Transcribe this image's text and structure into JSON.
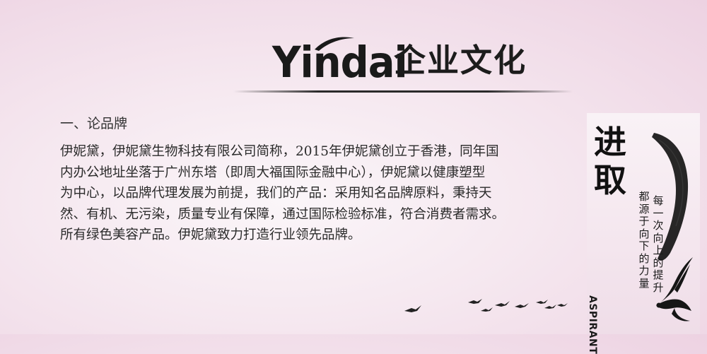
{
  "brand": {
    "logo_text": "Yindai",
    "title": "企业文化"
  },
  "section": {
    "heading": "一、论品牌",
    "lines": [
      "伊妮黛，伊妮黛生物科技有限公司简称，2015年伊妮黛创立于香港，同年国",
      "内办公地址坐落于广州东塔（即周大福国际金融中心），伊妮黛以健康塑型",
      "为中心，以品牌代理发展为前提，我们的产品：采用知名品牌原料，秉持天",
      "然、有机、无污染，质量专业有保障，通过国际检验标准，符合消费者需求。",
      "所有绿色美容产品。伊妮黛致力打造行业领先品牌。"
    ]
  },
  "artwork": {
    "calligraphy": "进取",
    "column1": "每一次向上的提升",
    "column2": "都源于向下的力量",
    "english": "ASPIRANT"
  },
  "colors": {
    "background": "#f5e7ef",
    "text": "#2b2b2b",
    "brand": "#1a1a1a"
  }
}
